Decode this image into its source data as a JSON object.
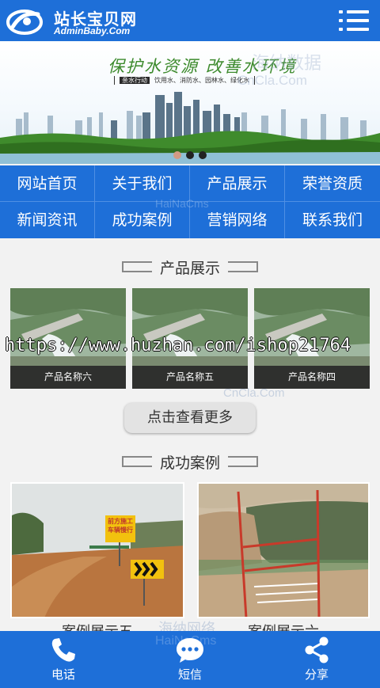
{
  "header": {
    "logo_cn": "站长宝贝网",
    "logo_en": "AdminBaby.Com"
  },
  "banner": {
    "title": "保护水资源 改善水环境",
    "tag_label": "亲水行动",
    "tag_text": "饮用水、消防水、园林水、绿化水",
    "slide_count": 3,
    "active_slide": 1
  },
  "nav": {
    "items": [
      {
        "label": "网站首页"
      },
      {
        "label": "关于我们"
      },
      {
        "label": "产品展示"
      },
      {
        "label": "荣誉资质"
      },
      {
        "label": "新闻资讯"
      },
      {
        "label": "成功案例"
      },
      {
        "label": "营销网络"
      },
      {
        "label": "联系我们"
      }
    ]
  },
  "products": {
    "title": "产品展示",
    "items": [
      {
        "name": "产品名称六"
      },
      {
        "name": "产品名称五"
      },
      {
        "name": "产品名称四"
      }
    ],
    "more_label": "点击查看更多"
  },
  "cases": {
    "title": "成功案例",
    "items": [
      {
        "name": "案例展示五",
        "sign": "前方施工 车辆慢行"
      },
      {
        "name": "案例展示六"
      }
    ]
  },
  "watermarks": {
    "url": "https://www.huzhan.com/ishop21764",
    "cncla": "CnCla.Com",
    "hainacms": "HaiNaCms",
    "cn_brand": "海纳数据",
    "hai_name": "海纳网络"
  },
  "footer": {
    "items": [
      {
        "label": "电话",
        "icon": "phone-icon"
      },
      {
        "label": "短信",
        "icon": "sms-icon"
      },
      {
        "label": "分享",
        "icon": "share-icon"
      }
    ]
  },
  "colors": {
    "primary": "#1e6fd8",
    "background": "#f2f2f2",
    "caption_bar": "#282828"
  }
}
